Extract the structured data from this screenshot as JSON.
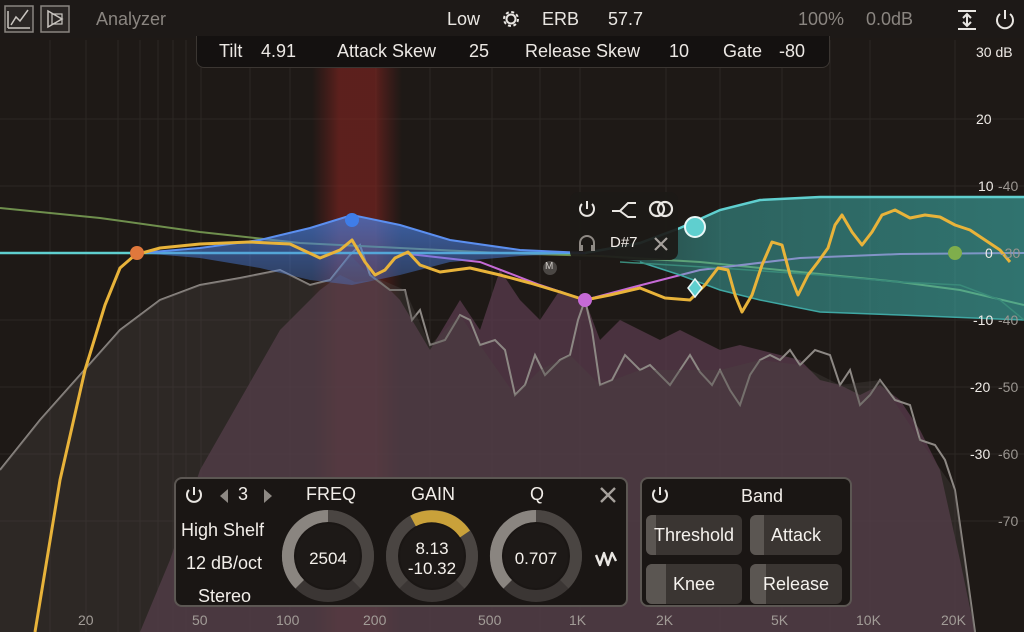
{
  "app": {
    "title": "Analyzer"
  },
  "topbar": {
    "quality": "Low",
    "scale_mode": "ERB",
    "scale_value": "57.7",
    "zoom": "100%",
    "output_gain": "0.0dB"
  },
  "dynamics_strip": {
    "tilt_label": "Tilt",
    "tilt_value": "4.91",
    "attack_skew_label": "Attack Skew",
    "attack_skew_value": "25",
    "release_skew_label": "Release Skew",
    "release_skew_value": "10",
    "gate_label": "Gate",
    "gate_value": "-80"
  },
  "db_scale": {
    "top": "30 dB",
    "right_labels": [
      "20",
      "10",
      "0",
      "-10",
      "-20",
      "-30",
      "-40",
      "-50",
      "-60",
      "-70"
    ],
    "overlay_labels": [
      "-20",
      "-30",
      "-40",
      "-50",
      "-60"
    ]
  },
  "freq_axis": [
    "20",
    "50",
    "100",
    "200",
    "500",
    "1K",
    "2K",
    "5K",
    "10K",
    "20K"
  ],
  "band_popup": {
    "note": "D#7",
    "marker": "M"
  },
  "band_panel": {
    "band_number": "3",
    "filter_type": "High Shelf",
    "slope": "12 dB/oct",
    "channel": "Stereo",
    "freq_label": "FREQ",
    "gain_label": "GAIN",
    "q_label": "Q",
    "freq_value": "2504",
    "gain_value_1": "8.13",
    "gain_value_2": "-10.32",
    "q_value": "0.707"
  },
  "dynamics_panel": {
    "title": "Band",
    "threshold": "Threshold",
    "attack": "Attack",
    "knee": "Knee",
    "release": "Release"
  },
  "colors": {
    "background": "#1e1916",
    "analyzer_fill": "#5a3b4e",
    "analyzer_line": "#8d8884",
    "eq_curve": "#e8b33a",
    "band_orange": "#e0783c",
    "band_blue": "#3f7de8",
    "band_purple": "#c56ad6",
    "band_cyan": "#5fcfcf",
    "band_green": "#7fae4c",
    "gain_ring": "#c9a13a"
  }
}
